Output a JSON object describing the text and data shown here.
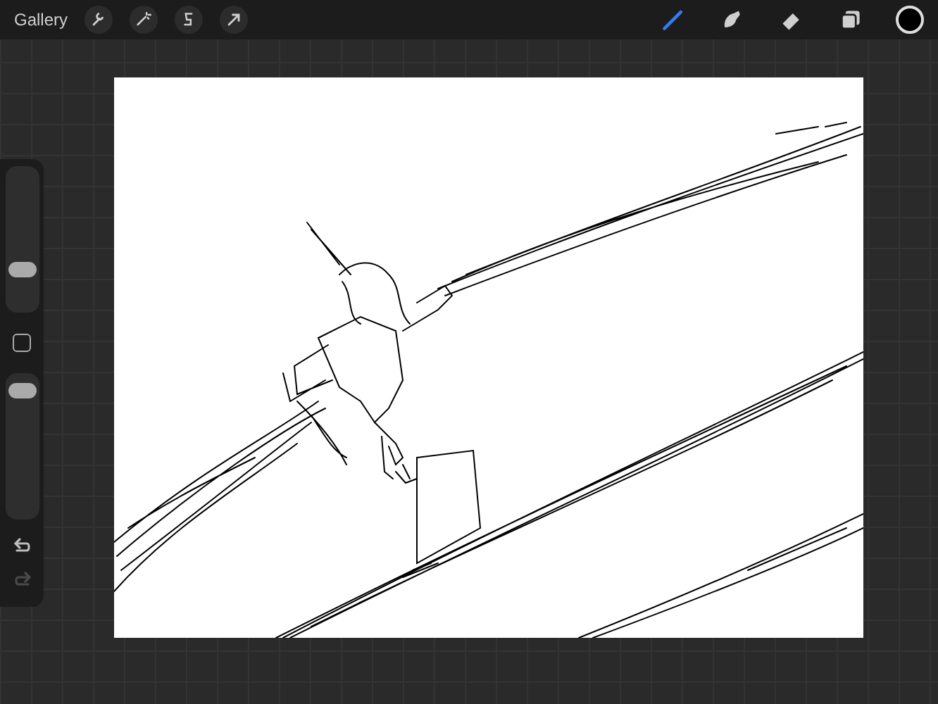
{
  "top_bar": {
    "gallery": "Gallery",
    "actions": [
      {
        "kind": "wrench"
      },
      {
        "kind": "wand"
      },
      {
        "kind": "selection"
      },
      {
        "kind": "transform"
      }
    ],
    "tools": [
      {
        "kind": "brush",
        "selected": true
      },
      {
        "kind": "smudge",
        "selected": false
      },
      {
        "kind": "eraser",
        "selected": false
      },
      {
        "kind": "layers",
        "selected": false
      }
    ],
    "color": "#000000"
  },
  "sidebar": {
    "brush_size": {
      "level": 0.27
    },
    "opacity": {
      "level": 0.92
    },
    "undo": {
      "disabled": false
    },
    "redo": {
      "disabled": true
    }
  }
}
